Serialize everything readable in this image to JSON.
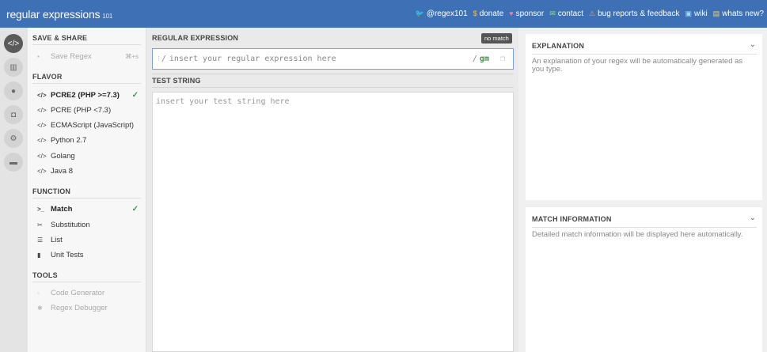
{
  "header": {
    "logo_main": "regular expressions",
    "logo_sup": "101",
    "nav": [
      {
        "icon": "twitter-icon",
        "glyph": "🐦",
        "label": "@regex101"
      },
      {
        "icon": "dollar-icon",
        "glyph": "$",
        "label": "donate"
      },
      {
        "icon": "heart-icon",
        "glyph": "♥",
        "label": "sponsor"
      },
      {
        "icon": "envelope-icon",
        "glyph": "✉",
        "label": "contact"
      },
      {
        "icon": "warning-icon",
        "glyph": "⚠",
        "label": "bug reports & feedback"
      },
      {
        "icon": "wiki-icon",
        "glyph": "▣",
        "label": "wiki"
      },
      {
        "icon": "book-icon",
        "glyph": "▤",
        "label": "whats new?"
      }
    ]
  },
  "sidebar": {
    "save_share": {
      "title": "SAVE & SHARE",
      "save_label": "Save Regex",
      "save_shortcut": "⌘+s"
    },
    "flavor": {
      "title": "FLAVOR",
      "items": [
        {
          "label": "PCRE2 (PHP >=7.3)",
          "selected": true
        },
        {
          "label": "PCRE (PHP <7.3)",
          "selected": false
        },
        {
          "label": "ECMAScript (JavaScript)",
          "selected": false
        },
        {
          "label": "Python 2.7",
          "selected": false
        },
        {
          "label": "Golang",
          "selected": false
        },
        {
          "label": "Java 8",
          "selected": false
        }
      ]
    },
    "function": {
      "title": "FUNCTION",
      "items": [
        {
          "label": "Match",
          "selected": true
        },
        {
          "label": "Substitution",
          "selected": false
        },
        {
          "label": "List",
          "selected": false
        },
        {
          "label": "Unit Tests",
          "selected": false
        }
      ]
    },
    "tools": {
      "title": "TOOLS",
      "items": [
        {
          "label": "Code Generator"
        },
        {
          "label": "Regex Debugger"
        }
      ]
    }
  },
  "editor": {
    "regex_label": "REGULAR EXPRESSION",
    "regex_delimiter": "/",
    "regex_placeholder": "insert your regular expression here",
    "regex_flags_slash": "/",
    "regex_flags": "gm",
    "match_status": "no match",
    "test_label": "TEST STRING",
    "test_placeholder": "insert your test string here"
  },
  "explanation": {
    "title": "EXPLANATION",
    "text": "An explanation of your regex will be automatically generated as you type."
  },
  "match_info": {
    "title": "MATCH INFORMATION",
    "text": "Detailed match information will be displayed here automatically."
  }
}
